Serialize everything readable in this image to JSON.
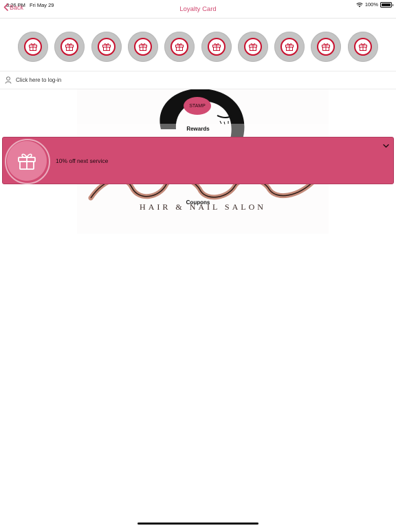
{
  "status_bar": {
    "time": "3:26 PM",
    "date": "Fri May 29",
    "battery": "100%"
  },
  "nav": {
    "back_label": "Back",
    "title": "Loyalty Card"
  },
  "stamps": {
    "count": 10
  },
  "login": {
    "text": "Click here to log-in"
  },
  "logo": {
    "tagline": "HAIR & NAIL SALON"
  },
  "stamp_button": {
    "label": "STAMP"
  },
  "rewards": {
    "heading": "Rewards",
    "items": [
      {
        "text": "10% off next service"
      }
    ]
  },
  "coupons": {
    "heading": "Coupons"
  },
  "colors": {
    "accent": "#d14b72",
    "stamp_ring": "#c8102e",
    "stamp_bg": "#c4c4c4"
  }
}
